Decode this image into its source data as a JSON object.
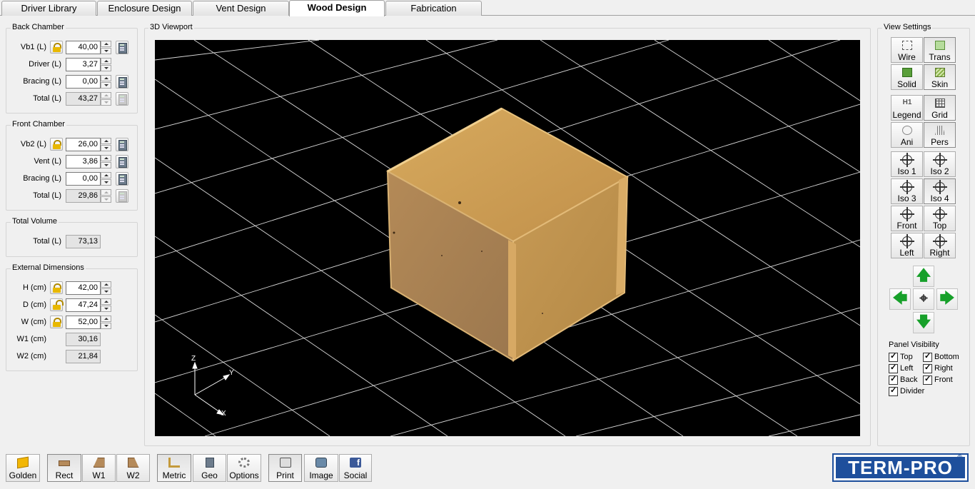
{
  "tabs": [
    "Driver Library",
    "Enclosure Design",
    "Vent Design",
    "Wood Design",
    "Fabrication"
  ],
  "back_chamber": {
    "title": "Back Chamber",
    "rows": [
      {
        "label": "Vb1 (L)",
        "value": "40,00"
      },
      {
        "label": "Driver (L)",
        "value": "3,27"
      },
      {
        "label": "Bracing (L)",
        "value": "0,00"
      },
      {
        "label": "Total (L)",
        "value": "43,27"
      }
    ]
  },
  "front_chamber": {
    "title": "Front Chamber",
    "rows": [
      {
        "label": "Vb2 (L)",
        "value": "26,00"
      },
      {
        "label": "Vent (L)",
        "value": "3,86"
      },
      {
        "label": "Bracing (L)",
        "value": "0,00"
      },
      {
        "label": "Total (L)",
        "value": "29,86"
      }
    ]
  },
  "total_volume": {
    "title": "Total Volume",
    "label": "Total (L)",
    "value": "73,13"
  },
  "external_dimensions": {
    "title": "External Dimensions",
    "rows": [
      {
        "label": "H (cm)",
        "value": "42,00"
      },
      {
        "label": "D (cm)",
        "value": "47,24"
      },
      {
        "label": "W (cm)",
        "value": "52,00"
      },
      {
        "label": "W1 (cm)",
        "value": "30,16"
      },
      {
        "label": "W2 (cm)",
        "value": "21,84"
      }
    ]
  },
  "viewport": {
    "title": "3D Viewport",
    "axes": {
      "z": "Z",
      "y": "Y",
      "x": "X"
    }
  },
  "view_settings": {
    "title": "View Settings",
    "buttons": [
      "Wire",
      "Trans",
      "Solid",
      "Skin",
      "Legend",
      "Grid",
      "Ani",
      "Pers",
      "Iso 1",
      "Iso 2",
      "Iso 3",
      "Iso 4",
      "Front",
      "Top",
      "Left",
      "Right"
    ],
    "icons": [
      "wire-icon",
      "trans-icon",
      "solid-icon",
      "skin-icon",
      "legend-icon",
      "grid-icon",
      "animate-icon",
      "perspective-icon",
      "iso1-icon",
      "iso2-icon",
      "iso3-icon",
      "iso4-icon",
      "front-view-icon",
      "top-view-icon",
      "left-view-icon",
      "right-view-icon"
    ],
    "arrows": {
      "up": "🡅",
      "left": "🡄",
      "center": "⌖",
      "right": "🡆",
      "down": "🡇"
    }
  },
  "panel_visibility": {
    "title": "Panel Visibility",
    "items": [
      "Top",
      "Bottom",
      "Left",
      "Right",
      "Back",
      "Front",
      "Divider"
    ]
  },
  "toolbar": [
    "Golden",
    "Rect",
    "W1",
    "W2",
    "Metric",
    "Geo",
    "Options",
    "Print",
    "Image",
    "Social"
  ],
  "logo": {
    "text": "TERM-PRO",
    "mark": "®"
  },
  "colors": {
    "wood": "#c99a52",
    "viewport_bg": "#000000",
    "accent_green": "#17a02a",
    "logo_blue": "#1e4f9c"
  }
}
